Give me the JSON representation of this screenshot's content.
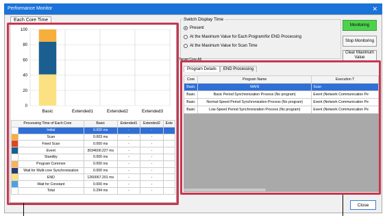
{
  "window": {
    "title": "Performance Monitor",
    "close": "✕"
  },
  "left_tab": "Each Core Time",
  "chart_data": {
    "type": "bar",
    "categories": [
      "Basic",
      "Extended1",
      "Extended2",
      "Extended3"
    ],
    "ylim": [
      0,
      100
    ],
    "yticks": [
      "0",
      "20",
      "40",
      "60",
      "80",
      "100"
    ],
    "stack": [
      {
        "value": 41,
        "color": "#fbe181"
      },
      {
        "value": 43,
        "color": "#1a5f8f"
      },
      {
        "value": 16,
        "color": "#f7ae3b"
      }
    ]
  },
  "table": {
    "headers": [
      "Processing Time of Each Core",
      "Basic",
      "Extended1",
      "Extended2",
      "Exte"
    ],
    "rows": [
      {
        "color": "#ffffff",
        "name": "Initial",
        "basic": "0.000 ms",
        "e1": "-",
        "e2": "-",
        "sel": true
      },
      {
        "color": "#f7ae3b",
        "name": "Scan",
        "basic": "0.003 ms",
        "e1": "-",
        "e2": "-"
      },
      {
        "color": "#e2461f",
        "name": "Fixed Scan",
        "basic": "0.000 ms",
        "e1": "-",
        "e2": "-"
      },
      {
        "color": "#1a5f8f",
        "name": "Event",
        "basic": "3034600.227 ms",
        "e1": "-",
        "e2": "-"
      },
      {
        "color": "#ffffff",
        "name": "Standby",
        "basic": "0.000 ms",
        "e1": "-",
        "e2": "-"
      },
      {
        "color": "#f7b65a",
        "name": "Program Common",
        "basic": "0.000 ms",
        "e1": "-",
        "e2": "-"
      },
      {
        "color": "#253a6a",
        "name": "Wait for Multi-core Synchronization",
        "basic": "0.000 ms",
        "e1": "-",
        "e2": "-"
      },
      {
        "color": "#fbe181",
        "name": "END",
        "basic": "1260067.201 ms",
        "e1": "-",
        "e2": "-"
      },
      {
        "color": "#4aa3e0",
        "name": "Wait for Constant",
        "basic": "0.000 ms",
        "e1": "-",
        "e2": "-"
      },
      {
        "color": "#ffffff",
        "name": "Total",
        "basic": "0.294 ms",
        "e1": "-",
        "e2": "-"
      }
    ]
  },
  "display": {
    "group_title": "Switch Display Time",
    "options": [
      "Present",
      "At the Maximum Value for Each Program/for END Processing",
      "At the Maximum Value for Scan Time"
    ]
  },
  "buttons": {
    "monitoring": "Monitoring",
    "stop": "Stop Monitoring",
    "clear": "Clear Maximum Value",
    "close": "Close"
  },
  "target_core": "Target Core  All",
  "inner_tabs": [
    "Program Details",
    "END Processing"
  ],
  "prog_table": {
    "headers": [
      "Core",
      "Program Name",
      "Execution T"
    ],
    "rows": [
      {
        "core": "Basic",
        "name": "MAIN",
        "exec": "Scan",
        "sel": true
      },
      {
        "core": "Basic",
        "name": "Basic Period Synchronization Process (No program)",
        "exec": "Event (Network Communication Pe"
      },
      {
        "core": "Basic",
        "name": "Normal-Speed Period Synchronization Process (No program)",
        "exec": "Event (Network Communication Pe"
      },
      {
        "core": "Basic",
        "name": "Low-Speed Period Synchronization Process (No program)",
        "exec": "Event (Network Communication Pe"
      }
    ]
  }
}
